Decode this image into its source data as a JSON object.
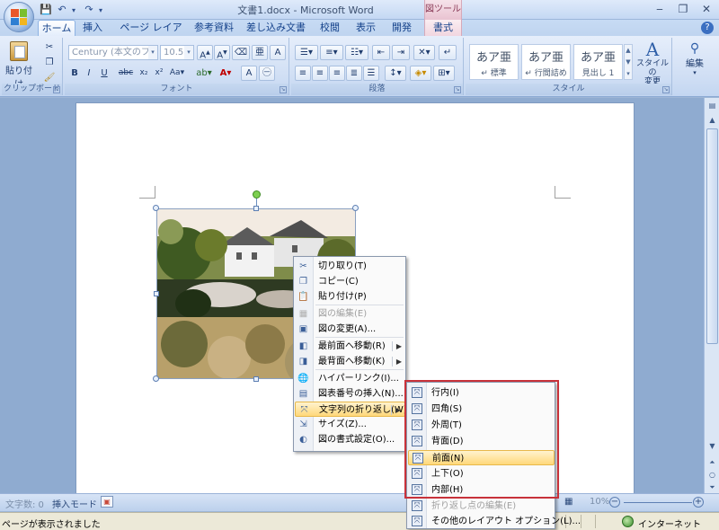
{
  "window": {
    "title": "文書1.docx - Microsoft Word",
    "tools_label": "図ツール"
  },
  "tabs": [
    "ホーム",
    "挿入",
    "ページ レイアウト",
    "参考資料",
    "差し込み文書",
    "校閲",
    "表示",
    "開発",
    "書式"
  ],
  "ribbon": {
    "clipboard": {
      "paste": "貼り付け",
      "label": "クリップボード"
    },
    "font": {
      "font_name": "Century (本文のフォント",
      "font_size": "10.5",
      "label": "フォント"
    },
    "paragraph": {
      "label": "段落"
    },
    "styles": {
      "items": [
        {
          "sample": "あア亜",
          "name": "↵ 標準"
        },
        {
          "sample": "あア亜",
          "name": "↵ 行間詰め"
        },
        {
          "sample": "あア亜",
          "name": "見出し 1"
        }
      ],
      "change": "スタイルの\n変更",
      "label": "スタイル"
    },
    "edit": "編集"
  },
  "context_menu": [
    {
      "label": "切り取り(T)",
      "icon": "scissors-icon",
      "glyph": "✂"
    },
    {
      "label": "コピー(C)",
      "icon": "copy-icon",
      "glyph": "❐"
    },
    {
      "label": "貼り付け(P)",
      "icon": "paste-icon",
      "glyph": "📋"
    },
    {
      "label": "図の編集(E)",
      "icon": "edit-picture-icon",
      "glyph": "▦",
      "disabled": true
    },
    {
      "label": "図の変更(A)...",
      "icon": "change-picture-icon",
      "glyph": "▣"
    },
    {
      "label": "最前面へ移動(R)",
      "icon": "bring-front-icon",
      "glyph": "◧",
      "submenu": true
    },
    {
      "label": "最背面へ移動(K)",
      "icon": "send-back-icon",
      "glyph": "◨",
      "submenu": true
    },
    {
      "label": "ハイパーリンク(I)...",
      "icon": "hyperlink-icon",
      "glyph": "🌐"
    },
    {
      "label": "図表番号の挿入(N)...",
      "icon": "caption-icon",
      "glyph": "▤"
    },
    {
      "label": "文字列の折り返し(W)",
      "icon": "text-wrap-icon",
      "glyph": "⤧",
      "submenu": true,
      "hover": true
    },
    {
      "label": "サイズ(Z)...",
      "icon": "size-icon",
      "glyph": "⇲"
    },
    {
      "label": "図の書式設定(O)...",
      "icon": "format-picture-icon",
      "glyph": "◐"
    }
  ],
  "wrap_submenu": [
    {
      "label": "行内(I)"
    },
    {
      "label": "四角(S)"
    },
    {
      "label": "外周(T)"
    },
    {
      "label": "背面(D)"
    },
    {
      "label": "前面(N)",
      "hover": true
    },
    {
      "label": "上下(O)"
    },
    {
      "label": "内部(H)"
    },
    {
      "label": "折り返し点の編集(E)",
      "disabled": true
    },
    {
      "label": "その他のレイアウト オプション(L)..."
    }
  ],
  "status": {
    "word_count": "文字数: 0",
    "insert_mode": "挿入モード",
    "zoom": "10%",
    "ie_message": "ページが表示されました",
    "ie_zone": "インターネット"
  },
  "colors": {
    "accent": "#15428b",
    "highlight": "#ffd87a",
    "annotation_red": "#c8323a"
  }
}
